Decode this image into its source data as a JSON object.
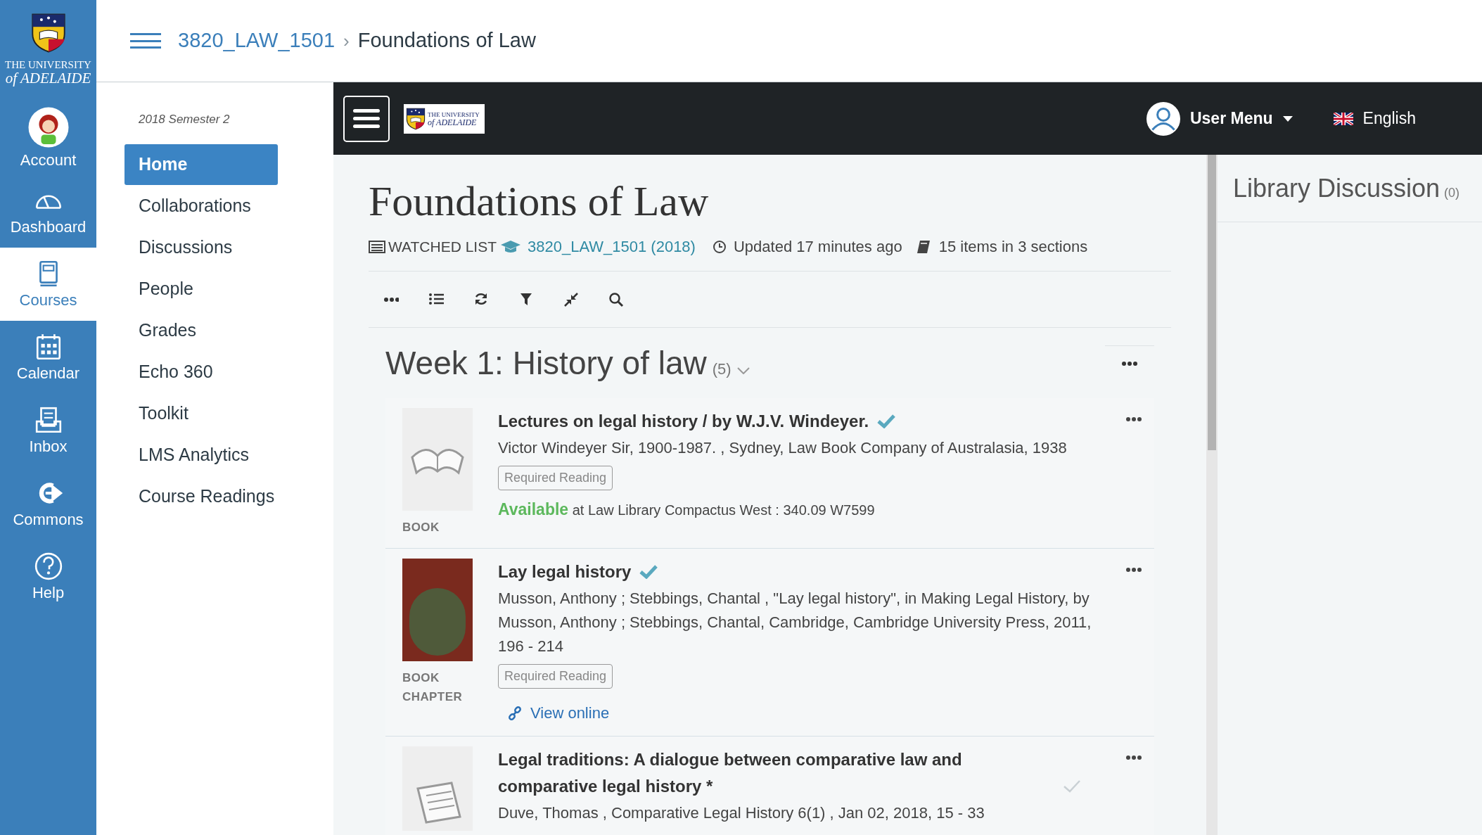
{
  "global_nav": {
    "logo": {
      "line_1": "THE UNIVERSITY",
      "line_2": "of ADELAIDE"
    },
    "items": [
      {
        "kind": "account",
        "label": "Account",
        "selected": false
      },
      {
        "kind": "dashboard",
        "label": "Dashboard",
        "selected": false
      },
      {
        "kind": "courses",
        "label": "Courses",
        "selected": true
      },
      {
        "kind": "calendar",
        "label": "Calendar",
        "selected": false
      },
      {
        "kind": "inbox",
        "label": "Inbox",
        "selected": false
      },
      {
        "kind": "commons",
        "label": "Commons",
        "selected": false
      },
      {
        "kind": "help",
        "label": "Help",
        "selected": false
      }
    ]
  },
  "breadcrumb": {
    "course": "3820_LAW_1501",
    "separator": "›",
    "page": "Foundations of Law"
  },
  "course_nav": {
    "term": "2018 Semester 2",
    "items": [
      {
        "label": "Home",
        "selected": true
      },
      {
        "label": "Collaborations",
        "selected": false
      },
      {
        "label": "Discussions",
        "selected": false
      },
      {
        "label": "People",
        "selected": false
      },
      {
        "label": "Grades",
        "selected": false
      },
      {
        "label": "Echo 360",
        "selected": false
      },
      {
        "label": "Toolkit",
        "selected": false
      },
      {
        "label": "LMS Analytics",
        "selected": false
      },
      {
        "label": "Course Readings",
        "selected": false
      }
    ]
  },
  "app_bar": {
    "logo": {
      "line_1": "THE UNIVERSITY",
      "line_2": "of ADELAIDE"
    },
    "user_menu": "User Menu",
    "language": "English"
  },
  "list": {
    "title": "Foundations of Law",
    "watched": "WATCHED LIST",
    "course_link": "3820_LAW_1501 (2018)",
    "updated": "Updated 17 minutes ago",
    "count": "15 items in 3 sections",
    "toolbar": [
      {
        "kind": "more"
      },
      {
        "kind": "list"
      },
      {
        "kind": "refresh"
      },
      {
        "kind": "filter"
      },
      {
        "kind": "collapse"
      },
      {
        "kind": "search"
      }
    ],
    "section": {
      "title": "Week 1: History of law",
      "count": "(5)",
      "items": [
        {
          "kind": "book",
          "type": "BOOK",
          "title": "Lectures on legal history / by W.J.V. Windeyer.",
          "read": true,
          "citation": "Victor Windeyer Sir, 1900-1987. , Sydney, Law Book Company of Australasia, 1938",
          "tag": "Required Reading",
          "availability": {
            "status": "Available",
            "location": "at Law Library Compactus West : 340.09 W7599"
          }
        },
        {
          "kind": "photo",
          "type": "BOOK CHAPTER",
          "title": "Lay legal history",
          "read": true,
          "citation": "Musson, Anthony ; Stebbings, Chantal , \"Lay legal history\", in Making Legal History, by Musson, Anthony ; Stebbings, Chantal, Cambridge, Cambridge University Press, 2011, 196 - 214",
          "tag": "Required Reading",
          "link": "View online"
        },
        {
          "kind": "article",
          "title": "Legal traditions: A dialogue between comparative law and comparative legal history *",
          "read": false,
          "citation": "Duve, Thomas , Comparative Legal History 6(1) , Jan 02, 2018, 15 - 33"
        }
      ]
    }
  },
  "side_panel": {
    "title": "Library Discussion",
    "count": "(0)"
  }
}
